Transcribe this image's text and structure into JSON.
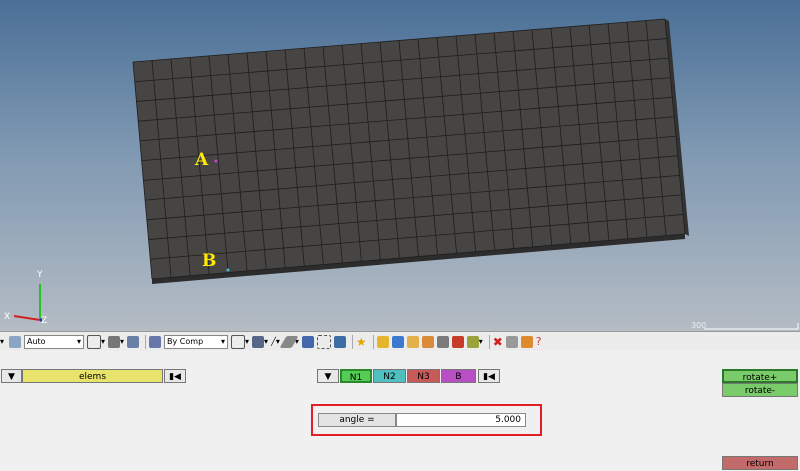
{
  "viewport": {
    "point_labels": [
      "A",
      "B"
    ],
    "triad": {
      "y": "Y",
      "x": "X",
      "z": "Z"
    },
    "scale": "300"
  },
  "toolbar": {
    "display_mode": "Auto",
    "color_mode": "By Comp"
  },
  "panel": {
    "entity_selector": "elems",
    "nodes": [
      {
        "label": "N1",
        "color": "#55cc55"
      },
      {
        "label": "N2",
        "color": "#4fbfc0"
      },
      {
        "label": "N3",
        "color": "#c85a5a"
      },
      {
        "label": "B",
        "color": "#b84fc4"
      }
    ],
    "angle_label": "angle =",
    "angle_value": "5.000",
    "rotate_plus": "rotate+",
    "rotate_minus": "rotate-",
    "return": "return"
  },
  "colors": {
    "selector_yellow": "#e8e36a",
    "rotate_green": "#7acb6a",
    "return_red": "#c36a6a",
    "highlight_red": "#e21f26"
  }
}
